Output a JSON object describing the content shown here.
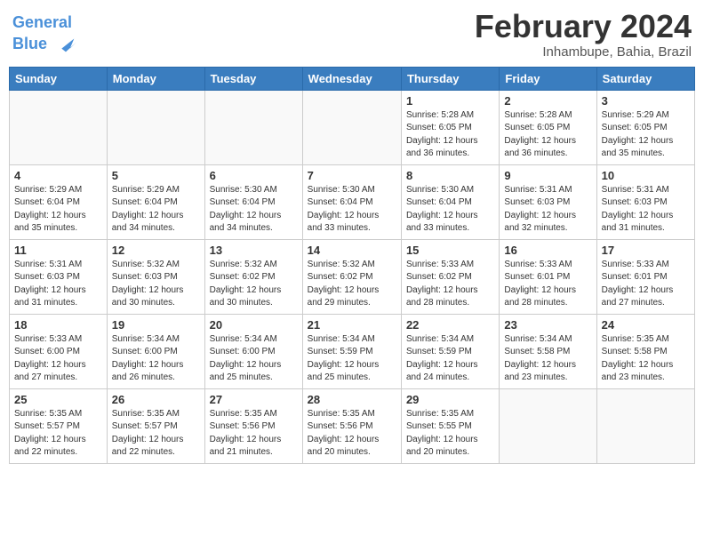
{
  "header": {
    "logo_line1": "General",
    "logo_line2": "Blue",
    "month_title": "February 2024",
    "location": "Inhambupe, Bahia, Brazil"
  },
  "weekdays": [
    "Sunday",
    "Monday",
    "Tuesday",
    "Wednesday",
    "Thursday",
    "Friday",
    "Saturday"
  ],
  "weeks": [
    [
      {
        "day": "",
        "info": ""
      },
      {
        "day": "",
        "info": ""
      },
      {
        "day": "",
        "info": ""
      },
      {
        "day": "",
        "info": ""
      },
      {
        "day": "1",
        "info": "Sunrise: 5:28 AM\nSunset: 6:05 PM\nDaylight: 12 hours\nand 36 minutes."
      },
      {
        "day": "2",
        "info": "Sunrise: 5:28 AM\nSunset: 6:05 PM\nDaylight: 12 hours\nand 36 minutes."
      },
      {
        "day": "3",
        "info": "Sunrise: 5:29 AM\nSunset: 6:05 PM\nDaylight: 12 hours\nand 35 minutes."
      }
    ],
    [
      {
        "day": "4",
        "info": "Sunrise: 5:29 AM\nSunset: 6:04 PM\nDaylight: 12 hours\nand 35 minutes."
      },
      {
        "day": "5",
        "info": "Sunrise: 5:29 AM\nSunset: 6:04 PM\nDaylight: 12 hours\nand 34 minutes."
      },
      {
        "day": "6",
        "info": "Sunrise: 5:30 AM\nSunset: 6:04 PM\nDaylight: 12 hours\nand 34 minutes."
      },
      {
        "day": "7",
        "info": "Sunrise: 5:30 AM\nSunset: 6:04 PM\nDaylight: 12 hours\nand 33 minutes."
      },
      {
        "day": "8",
        "info": "Sunrise: 5:30 AM\nSunset: 6:04 PM\nDaylight: 12 hours\nand 33 minutes."
      },
      {
        "day": "9",
        "info": "Sunrise: 5:31 AM\nSunset: 6:03 PM\nDaylight: 12 hours\nand 32 minutes."
      },
      {
        "day": "10",
        "info": "Sunrise: 5:31 AM\nSunset: 6:03 PM\nDaylight: 12 hours\nand 31 minutes."
      }
    ],
    [
      {
        "day": "11",
        "info": "Sunrise: 5:31 AM\nSunset: 6:03 PM\nDaylight: 12 hours\nand 31 minutes."
      },
      {
        "day": "12",
        "info": "Sunrise: 5:32 AM\nSunset: 6:03 PM\nDaylight: 12 hours\nand 30 minutes."
      },
      {
        "day": "13",
        "info": "Sunrise: 5:32 AM\nSunset: 6:02 PM\nDaylight: 12 hours\nand 30 minutes."
      },
      {
        "day": "14",
        "info": "Sunrise: 5:32 AM\nSunset: 6:02 PM\nDaylight: 12 hours\nand 29 minutes."
      },
      {
        "day": "15",
        "info": "Sunrise: 5:33 AM\nSunset: 6:02 PM\nDaylight: 12 hours\nand 28 minutes."
      },
      {
        "day": "16",
        "info": "Sunrise: 5:33 AM\nSunset: 6:01 PM\nDaylight: 12 hours\nand 28 minutes."
      },
      {
        "day": "17",
        "info": "Sunrise: 5:33 AM\nSunset: 6:01 PM\nDaylight: 12 hours\nand 27 minutes."
      }
    ],
    [
      {
        "day": "18",
        "info": "Sunrise: 5:33 AM\nSunset: 6:00 PM\nDaylight: 12 hours\nand 27 minutes."
      },
      {
        "day": "19",
        "info": "Sunrise: 5:34 AM\nSunset: 6:00 PM\nDaylight: 12 hours\nand 26 minutes."
      },
      {
        "day": "20",
        "info": "Sunrise: 5:34 AM\nSunset: 6:00 PM\nDaylight: 12 hours\nand 25 minutes."
      },
      {
        "day": "21",
        "info": "Sunrise: 5:34 AM\nSunset: 5:59 PM\nDaylight: 12 hours\nand 25 minutes."
      },
      {
        "day": "22",
        "info": "Sunrise: 5:34 AM\nSunset: 5:59 PM\nDaylight: 12 hours\nand 24 minutes."
      },
      {
        "day": "23",
        "info": "Sunrise: 5:34 AM\nSunset: 5:58 PM\nDaylight: 12 hours\nand 23 minutes."
      },
      {
        "day": "24",
        "info": "Sunrise: 5:35 AM\nSunset: 5:58 PM\nDaylight: 12 hours\nand 23 minutes."
      }
    ],
    [
      {
        "day": "25",
        "info": "Sunrise: 5:35 AM\nSunset: 5:57 PM\nDaylight: 12 hours\nand 22 minutes."
      },
      {
        "day": "26",
        "info": "Sunrise: 5:35 AM\nSunset: 5:57 PM\nDaylight: 12 hours\nand 22 minutes."
      },
      {
        "day": "27",
        "info": "Sunrise: 5:35 AM\nSunset: 5:56 PM\nDaylight: 12 hours\nand 21 minutes."
      },
      {
        "day": "28",
        "info": "Sunrise: 5:35 AM\nSunset: 5:56 PM\nDaylight: 12 hours\nand 20 minutes."
      },
      {
        "day": "29",
        "info": "Sunrise: 5:35 AM\nSunset: 5:55 PM\nDaylight: 12 hours\nand 20 minutes."
      },
      {
        "day": "",
        "info": ""
      },
      {
        "day": "",
        "info": ""
      }
    ]
  ]
}
